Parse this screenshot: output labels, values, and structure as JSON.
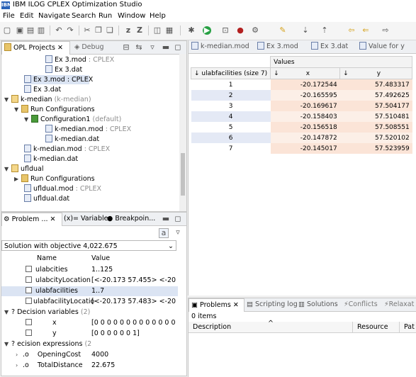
{
  "window": {
    "title": "IBM ILOG CPLEX Optimization Studio"
  },
  "menu": [
    "File",
    "Edit",
    "Navigate",
    "Search",
    "Run",
    "Window",
    "Help"
  ],
  "projects_view": {
    "tab_label": "OPL Projects",
    "debug_tab_label": "Debug",
    "tree": [
      {
        "label": "Ex 3.mod",
        "suffix": ": CPLEX",
        "icon": "mod-file-icon"
      },
      {
        "label": "Ex 3.dat",
        "suffix": "",
        "icon": "dat-file-icon"
      },
      {
        "label": "Ex 3.mod : CPLEX",
        "suffix": "",
        "icon": "mod-file-icon",
        "selected": true
      },
      {
        "label": "Ex 3.dat",
        "suffix": "",
        "icon": "dat-file-icon"
      },
      {
        "label": "k-median",
        "suffix": "(k-median)",
        "icon": "project-icon"
      },
      {
        "label": "Run Configurations",
        "suffix": "",
        "icon": "folder-icon"
      },
      {
        "label": "Configuration1",
        "suffix": "(default)",
        "icon": "config-icon"
      },
      {
        "label": "k-median.mod",
        "suffix": ": CPLEX",
        "icon": "mod-file-icon"
      },
      {
        "label": "k-median.dat",
        "suffix": "",
        "icon": "dat-file-icon"
      },
      {
        "label": "k-median.mod",
        "suffix": ": CPLEX",
        "icon": "mod-file-icon"
      },
      {
        "label": "k-median.dat",
        "suffix": "",
        "icon": "dat-file-icon"
      },
      {
        "label": "ufldual",
        "suffix": "",
        "icon": "project-icon"
      },
      {
        "label": "Run Configurations",
        "suffix": "",
        "icon": "folder-icon"
      },
      {
        "label": "ufldual.mod",
        "suffix": ": CPLEX",
        "icon": "mod-file-icon"
      },
      {
        "label": "ufldual.dat",
        "suffix": "",
        "icon": "dat-file-icon"
      }
    ]
  },
  "problem_view": {
    "tabs": [
      "Problem ...",
      "Variables",
      "Breakpoin..."
    ],
    "solution": "Solution with objective 4,022.675",
    "col_name": "Name",
    "col_value": "Value",
    "rows": [
      {
        "name": "ulabcities",
        "value": "1..125"
      },
      {
        "name": "ulabcityLocation",
        "value": "[<-20.173 57.455> <-20.16..."
      },
      {
        "name": "ulabfacilities",
        "value": "1..7"
      },
      {
        "name": "ulabfacilityLocatio",
        "value": "[<-20.173 57.483> <-20.16..."
      },
      {
        "name": "Decision variables",
        "value": "",
        "count": "(2)"
      },
      {
        "name": "x",
        "value": "[0 0 0 0 0 0 0 0 0 0 0 0 0 0 0 0"
      },
      {
        "name": "y",
        "value": "[0 0 0 0 0 0 1]"
      },
      {
        "name": "ecision expressions",
        "value": "",
        "count": "(2"
      },
      {
        "name": "OpeningCost",
        "value": "4000"
      },
      {
        "name": "TotalDistance",
        "value": "22.675"
      }
    ]
  },
  "editor": {
    "tabs": [
      "k-median.mod",
      "Ex 3.mod",
      "Ex 3.dat",
      "Value for y"
    ],
    "values_header": "Values",
    "index_header": "ulabfacilities  (size 7)",
    "x_header": "x",
    "y_header": "y",
    "rows": [
      {
        "i": "1",
        "x": "-20.172544",
        "y": "57.483317"
      },
      {
        "i": "2",
        "x": "-20.165595",
        "y": "57.492625"
      },
      {
        "i": "3",
        "x": "-20.169617",
        "y": "57.504177"
      },
      {
        "i": "4",
        "x": "-20.158403",
        "y": "57.510481"
      },
      {
        "i": "5",
        "x": "-20.156518",
        "y": "57.508551"
      },
      {
        "i": "6",
        "x": "-20.147872",
        "y": "57.520102"
      },
      {
        "i": "7",
        "x": "-20.145017",
        "y": "57.523959"
      }
    ]
  },
  "problems_view": {
    "tabs": [
      "Problems",
      "Scripting log",
      "Solutions",
      "Conflicts",
      "Relaxat"
    ],
    "count": "0 items",
    "columns": [
      "Description",
      "Resource",
      "Pat"
    ]
  }
}
